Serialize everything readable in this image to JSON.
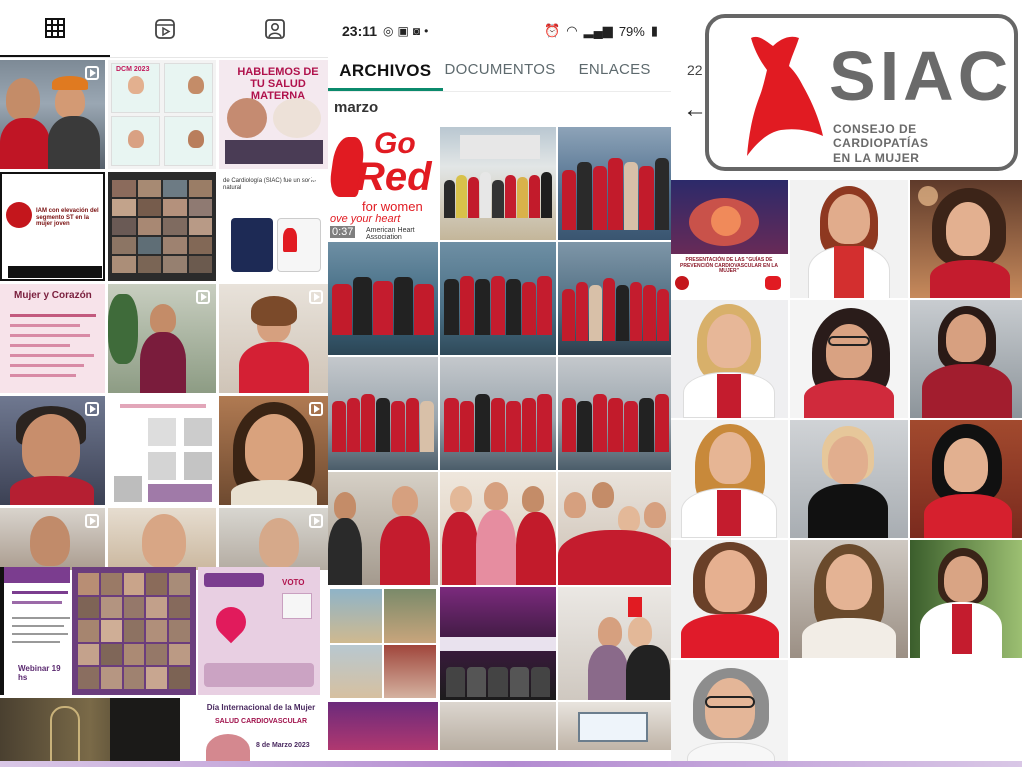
{
  "profile_panel": {
    "tabs": [
      {
        "icon": "grid-icon",
        "active": true
      },
      {
        "icon": "reels-icon",
        "active": false
      },
      {
        "icon": "tagged-icon",
        "active": false
      }
    ],
    "tiles": [
      {
        "kind": "photo",
        "text": ""
      },
      {
        "kind": "flyer",
        "text": "DCM 2023"
      },
      {
        "kind": "flyer",
        "text": "HABLEMOS DE TU SALUD MATERNA"
      },
      {
        "kind": "slide",
        "text": "IAM con elevación del segmento ST en la mujer joven"
      },
      {
        "kind": "video-call",
        "text": ""
      },
      {
        "kind": "flyer",
        "text": "de Cardiología (SIAC) fue un socio natural"
      },
      {
        "kind": "flyer",
        "text": "Mujer y Corazón"
      },
      {
        "kind": "reel",
        "text": ""
      },
      {
        "kind": "reel",
        "text": ""
      },
      {
        "kind": "reel",
        "text": ""
      },
      {
        "kind": "slide",
        "text": ""
      },
      {
        "kind": "reel",
        "text": ""
      },
      {
        "kind": "reel",
        "text": ""
      },
      {
        "kind": "reel",
        "text": ""
      },
      {
        "kind": "reel",
        "text": ""
      }
    ],
    "row6_text": {
      "left": "Webinar 19 hs",
      "right": "VOTO"
    },
    "row7_text": {
      "title": "Día Internacional de la Mujer",
      "subtitle": "SALUD CARDIOVASCULAR",
      "date": "8 de Marzo 2023"
    }
  },
  "media_panel": {
    "status": {
      "time": "23:11",
      "battery": "79%"
    },
    "tabs": [
      {
        "label": "ARCHIVOS",
        "active": true
      },
      {
        "label": "DOCUMENTOS",
        "active": false
      },
      {
        "label": "ENLACES",
        "active": false
      }
    ],
    "month": "marzo",
    "go_red": {
      "line1": "Go",
      "line2": "Red",
      "line3": "for women",
      "line4": "ove your heart",
      "duration": "0:37",
      "org": "American Heart Association"
    }
  },
  "siac_panel": {
    "time_fragment": "22",
    "logo": {
      "word": "SIAC",
      "tagline_1": "CONSEJO DE CARDIOPATÍAS",
      "tagline_2": "EN LA MUJER"
    },
    "presentation_title": "PRESENTACIÓN DE LAS \"GUÍAS DE PREVENCIÓN CARDIOVASCULAR EN LA MUJER\""
  },
  "colors": {
    "accent_red": "#e11b22",
    "whatsapp_green": "#0b8a6c",
    "logo_gray": "#6a6a6a"
  }
}
